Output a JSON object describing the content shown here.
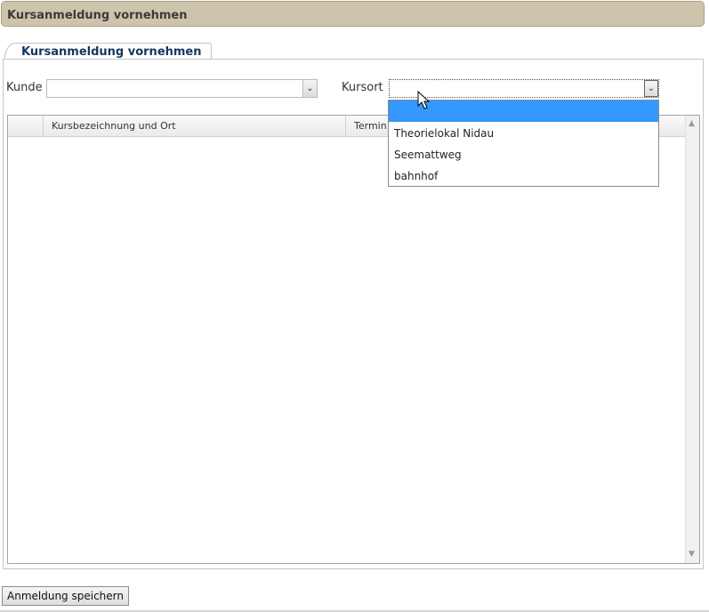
{
  "panel": {
    "title": "Kursanmeldung vornehmen"
  },
  "tabs": [
    {
      "label": "Kursanmeldung vornehmen",
      "active": true
    }
  ],
  "form": {
    "kunde": {
      "label": "Kunde",
      "value": ""
    },
    "kursort": {
      "label": "Kursort",
      "value": ""
    }
  },
  "grid": {
    "columns": [
      {
        "label": ""
      },
      {
        "label": "Kursbezeichnung und Ort"
      },
      {
        "label": "Termin"
      }
    ],
    "rows": []
  },
  "kursort_dropdown": {
    "open": true,
    "selected_index": 0,
    "options": [
      "",
      "Theorielokal Nidau",
      "Seemattweg",
      "bahnhof"
    ]
  },
  "icons": {
    "combo_trigger": "chevron-down-icon",
    "cursor": "mouse-pointer-icon",
    "scroll_up": "scroll-up-icon",
    "scroll_down": "scroll-down-icon"
  },
  "colors": {
    "header_bg": "#cdc4ac",
    "tab_label": "#15385f",
    "dropdown_selected": "#3399ff"
  },
  "actions": {
    "save_label": "Anmeldung speichern"
  }
}
